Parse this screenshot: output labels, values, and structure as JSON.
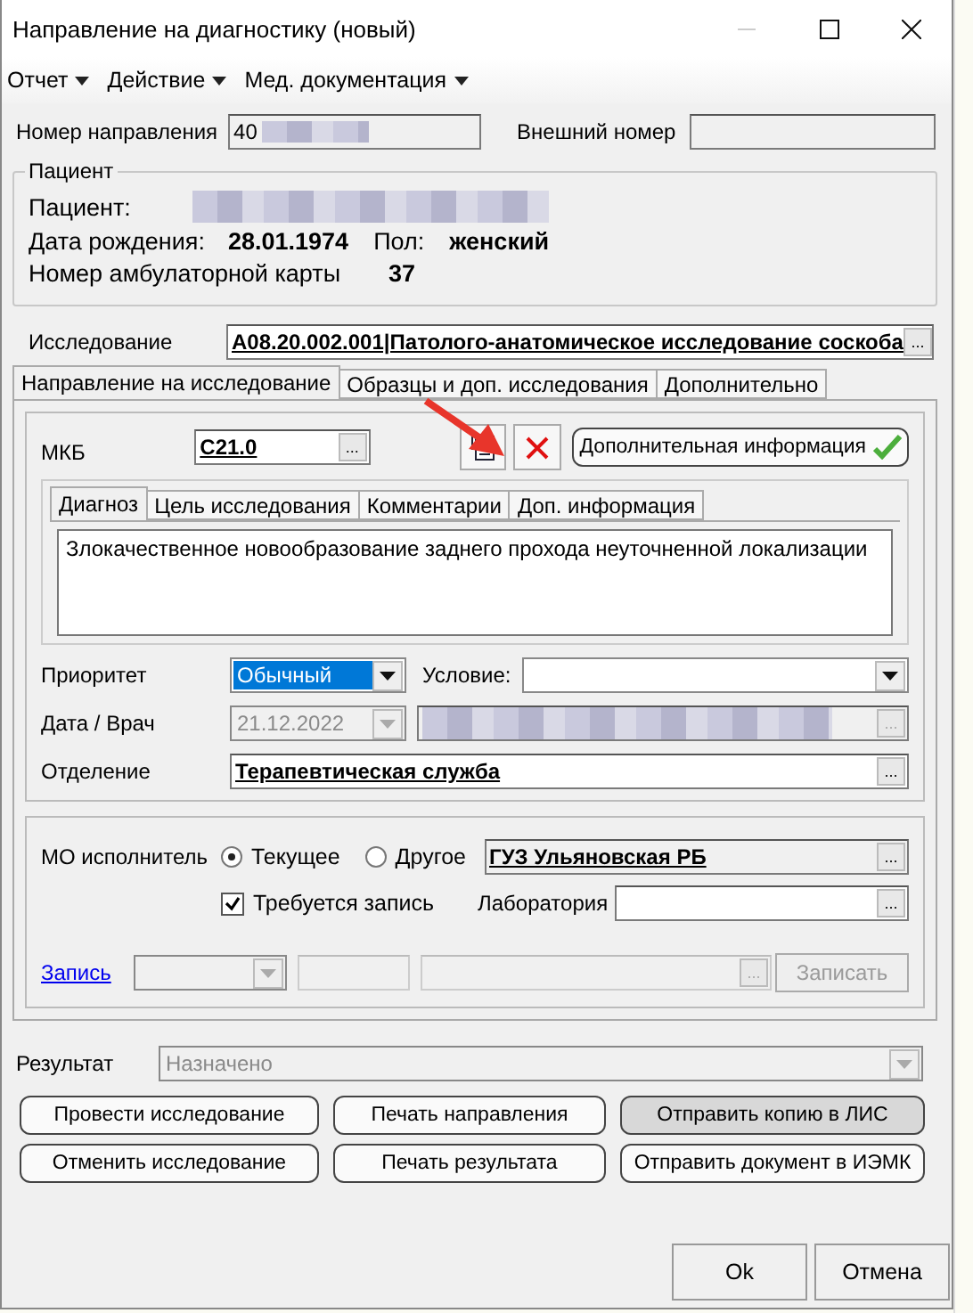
{
  "window": {
    "title": "Направление на диагностику (новый)"
  },
  "menu": [
    {
      "label": "Отчет"
    },
    {
      "label": "Действие"
    },
    {
      "label": "Мед. документация"
    }
  ],
  "header": {
    "number_label": "Номер направления",
    "number_value": "40",
    "external_label": "Внешний номер"
  },
  "patient": {
    "group_title": "Пациент",
    "name_label": "Пациент:",
    "birth_label": "Дата рождения:",
    "birth_value": "28.01.1974",
    "sex_label": "Пол:",
    "sex_value": "женский",
    "card_label": "Номер амбулаторной карты",
    "card_value": "37"
  },
  "study": {
    "label": "Исследование",
    "value": "A08.20.002.001|Патолого-анатомическое исследование соскоба",
    "browse": "..."
  },
  "tabs": [
    {
      "label": "Направление на исследование",
      "selected": true
    },
    {
      "label": "Образцы и доп. исследования",
      "selected": false
    },
    {
      "label": "Дополнительно",
      "selected": false
    }
  ],
  "mkb": {
    "label": "МКБ",
    "value": "C21.0",
    "browse": "..."
  },
  "extra_info_button": {
    "label": "Дополнительная информация",
    "checked": true
  },
  "inner_tabs": [
    {
      "label": "Диагноз",
      "selected": true
    },
    {
      "label": "Цель исследования",
      "selected": false
    },
    {
      "label": "Комментарии",
      "selected": false
    },
    {
      "label": "Доп. информация",
      "selected": false
    }
  ],
  "diagnosis_text": "Злокачественное новообразование заднего прохода неуточненной локализации",
  "priority": {
    "label": "Приоритет",
    "value": "Обычный"
  },
  "condition": {
    "label": "Условие:"
  },
  "date_doctor": {
    "label": "Дата / Врач",
    "date": "21.12.2022",
    "browse": "..."
  },
  "department": {
    "label": "Отделение",
    "value": "Терапевтическая служба",
    "browse": "..."
  },
  "executor": {
    "label": "МО исполнитель",
    "options": [
      {
        "label": "Текущее",
        "selected": true
      },
      {
        "label": "Другое",
        "selected": false
      }
    ],
    "org": "ГУЗ Ульяновская РБ",
    "org_browse": "...",
    "requires_booking": {
      "label": "Требуется запись",
      "checked": true
    },
    "lab_label": "Лаборатория",
    "lab_browse": "..."
  },
  "booking": {
    "link": "Запись",
    "slot_browse": "...",
    "button": "Записать",
    "disabled": true
  },
  "result": {
    "label": "Результат",
    "value": "Назначено",
    "disabled": true
  },
  "actions": [
    {
      "label": "Провести исследование",
      "highlighted": false
    },
    {
      "label": "Печать направления",
      "highlighted": false
    },
    {
      "label": "Отправить копию в ЛИС",
      "highlighted": true
    },
    {
      "label": "Отменить исследование",
      "highlighted": false
    },
    {
      "label": "Печать результата",
      "highlighted": false
    },
    {
      "label": "Отправить документ в ИЭМК",
      "highlighted": false
    }
  ],
  "footer": [
    {
      "label": "Ok"
    },
    {
      "label": "Отмена"
    }
  ]
}
